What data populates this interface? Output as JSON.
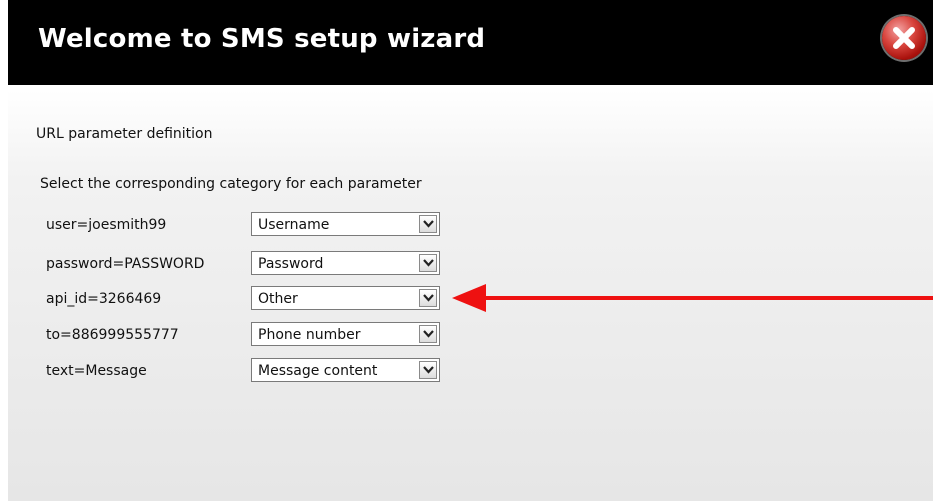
{
  "dialog": {
    "title": "Welcome to SMS setup wizard",
    "close_icon": "close-x-icon"
  },
  "form": {
    "section_title": "URL parameter definition",
    "instructions": "Select the corresponding category for each parameter",
    "rows": [
      {
        "label": "user=joesmith99",
        "selected": "Username"
      },
      {
        "label": "password=PASSWORD",
        "selected": "Password"
      },
      {
        "label": "api_id=3266469",
        "selected": "Other"
      },
      {
        "label": "to=886999555777",
        "selected": "Phone number"
      },
      {
        "label": "text=Message",
        "selected": "Message content"
      }
    ]
  },
  "annotation": {
    "icon": "red-arrow-left-icon",
    "color": "#ee1111"
  },
  "colors": {
    "titlebar": "#000000",
    "title_text": "#ffffff",
    "close_button": "#c0211a"
  }
}
